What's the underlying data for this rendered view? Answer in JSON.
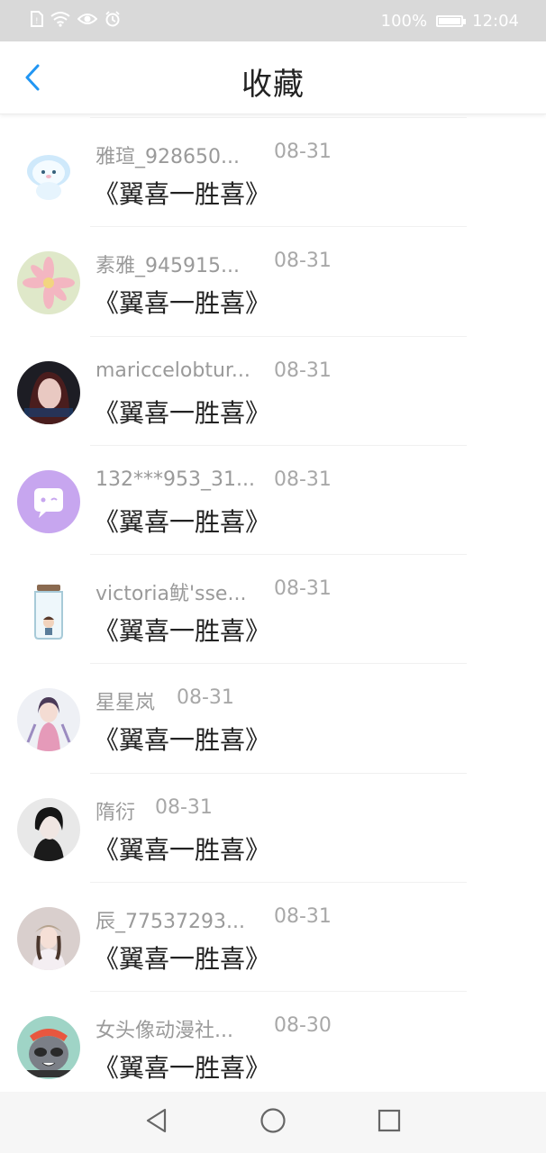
{
  "status_bar": {
    "battery": "100%",
    "battery_level": 1.0,
    "time": "12:04",
    "icons": [
      "sim-icon",
      "wifi-icon",
      "eye-icon",
      "alarm-icon"
    ]
  },
  "header": {
    "title": "收藏",
    "back_icon": "chevron-left-icon",
    "accent_color": "#2196f3"
  },
  "items": [
    {
      "name": "雅瑄_928650...",
      "date": "08-31",
      "book": "《翼喜一胜喜》",
      "avatar": "cartoon-bunny"
    },
    {
      "name": "素雅_945915...",
      "date": "08-31",
      "book": "《翼喜一胜喜》",
      "avatar": "pink-flower"
    },
    {
      "name": "mariccelobtur...",
      "date": "08-31",
      "book": "《翼喜一胜喜》",
      "avatar": "dark-portrait"
    },
    {
      "name": "132***953_31...",
      "date": "08-31",
      "book": "《翼喜一胜喜》",
      "avatar": "purple-chat"
    },
    {
      "name": "victoria鱿'sse...",
      "date": "08-31",
      "book": "《翼喜一胜喜》",
      "avatar": "jar-boy"
    },
    {
      "name": "星星岚",
      "date": "08-31",
      "book": "《翼喜一胜喜》",
      "avatar": "anime-girl"
    },
    {
      "name": "隋衍",
      "date": "08-31",
      "book": "《翼喜一胜喜》",
      "avatar": "anime-boy"
    },
    {
      "name": "辰_77537293...",
      "date": "08-31",
      "book": "《翼喜一胜喜》",
      "avatar": "girl-hat"
    },
    {
      "name": "女头像动漫社...",
      "date": "08-30",
      "book": "《翼喜一胜喜》",
      "avatar": "cartoon-raccoon"
    }
  ],
  "nav": {
    "back": "triangle-back-icon",
    "home": "circle-home-icon",
    "recents": "square-recents-icon"
  }
}
